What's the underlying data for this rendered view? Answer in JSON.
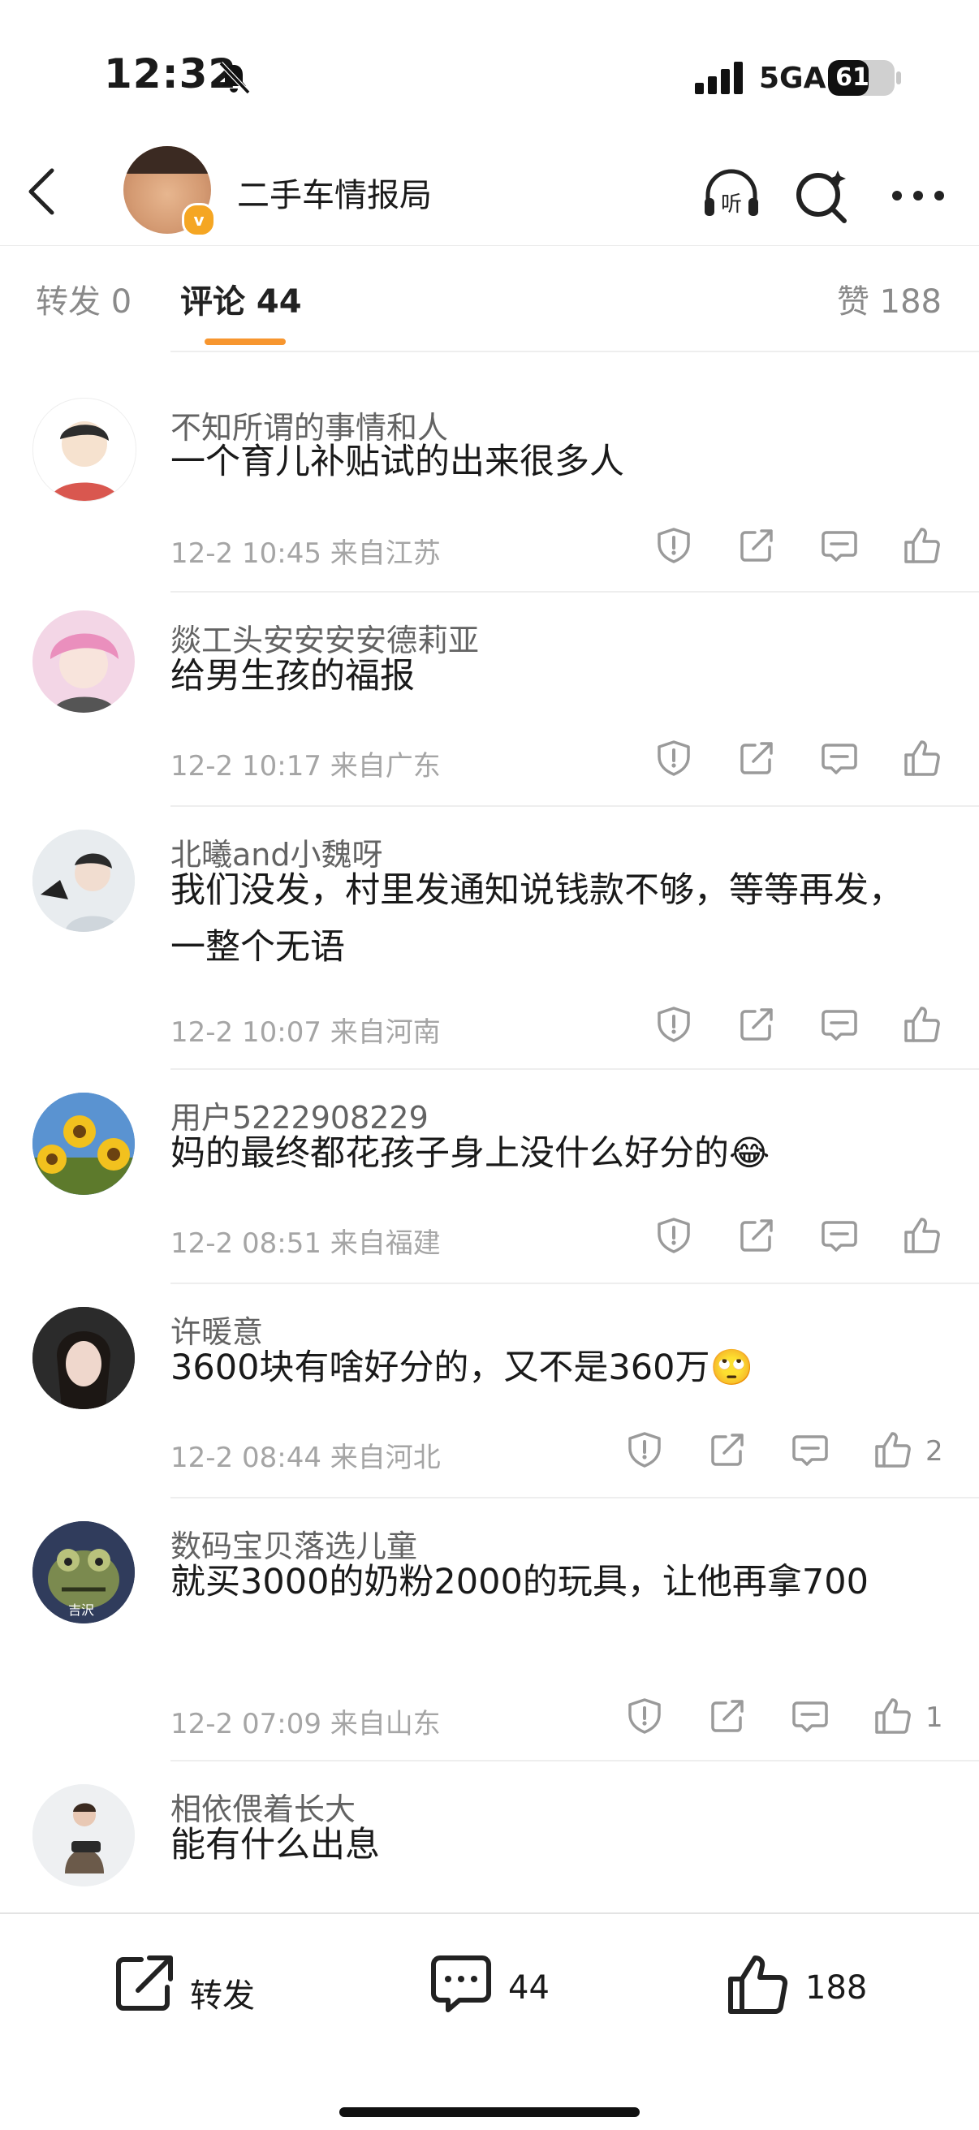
{
  "status_bar": {
    "time": "12:32",
    "network": "5GA",
    "battery_level": "61",
    "battery_percent": 61
  },
  "header": {
    "title": "二手车情报局",
    "verified_badge": "v"
  },
  "tabs": {
    "repost": "转发 0",
    "comment": "评论 44",
    "like": "赞 188"
  },
  "comments": [
    {
      "user": "不知所谓的事情和人",
      "text": "一个育儿补贴试的出来很多人",
      "meta": "12-2 10:45  来自江苏",
      "likes": ""
    },
    {
      "user": "燚工头安安安安德莉亚",
      "text": "给男生孩的福报",
      "meta": "12-2 10:17  来自广东",
      "likes": ""
    },
    {
      "user": "北曦and小魏呀",
      "text": "我们没发，村里发通知说钱款不够，等等再发，一整个无语",
      "meta": "12-2 10:07  来自河南",
      "likes": ""
    },
    {
      "user": "用户5222908229",
      "text": "妈的最终都花孩子身上没什么好分的😂",
      "meta": "12-2 08:51  来自福建",
      "likes": ""
    },
    {
      "user": "许暖意",
      "text": "3600块有啥好分的，又不是360万🙄",
      "meta": "12-2 08:44  来自河北",
      "likes": "2"
    },
    {
      "user": "数码宝贝落选儿童",
      "text": "就买3000的奶粉2000的玩具，让他再拿700",
      "meta": "12-2 07:09  来自山东",
      "likes": "1"
    },
    {
      "user": "相依偎着长大",
      "text": "能有什么出息",
      "meta": "",
      "likes": ""
    }
  ],
  "avatar_caption": "吉沢",
  "bottom_bar": {
    "repost_label": "转发",
    "comment_count": "44",
    "like_count": "188"
  },
  "colors": {
    "accent": "#f7962f",
    "badge": "#f5a623",
    "text": "#1a1a1a",
    "meta": "#a5a5a5"
  },
  "icons": [
    "back-chevron-icon",
    "headphones-listen-icon",
    "search-sparkle-icon",
    "more-dots-icon",
    "report-shield-icon",
    "repost-icon",
    "comment-bubble-icon",
    "thumbs-up-icon"
  ]
}
